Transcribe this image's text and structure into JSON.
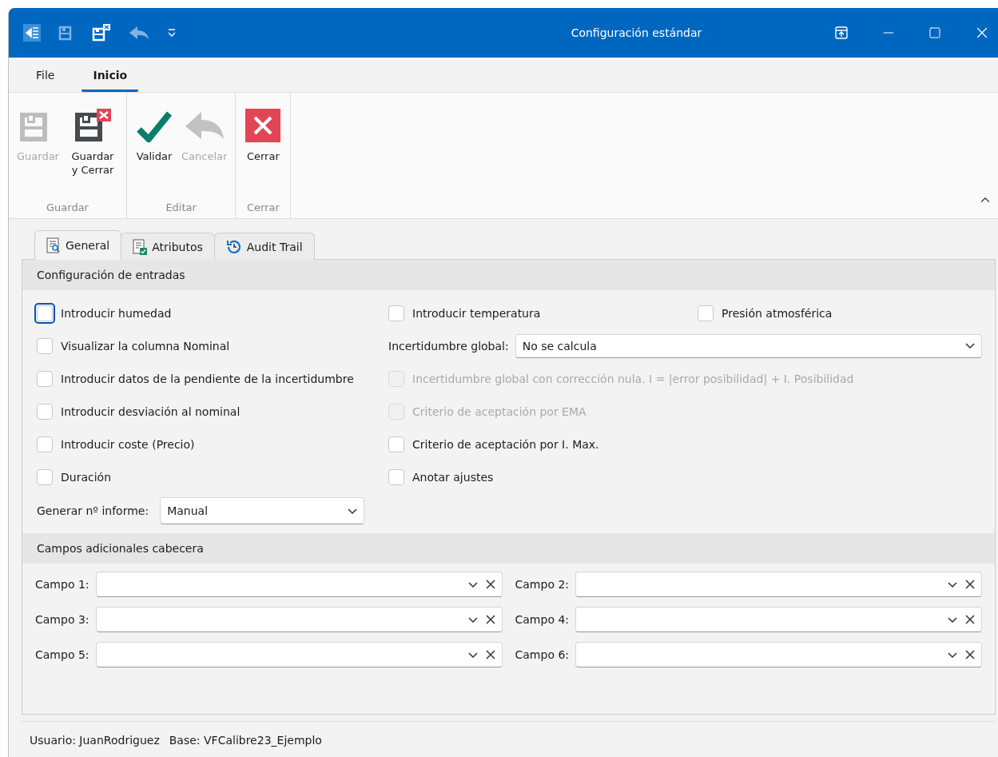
{
  "window": {
    "title": "Configuración estándar"
  },
  "ribbon": {
    "tabs": [
      {
        "label": "File",
        "selected": false
      },
      {
        "label": "Inicio",
        "selected": true
      }
    ],
    "groups": [
      {
        "label": "Guardar",
        "buttons": [
          {
            "label": "Guardar",
            "kind": "save",
            "disabled": true
          },
          {
            "label": "Guardar y Cerrar",
            "kind": "save-close",
            "disabled": false
          }
        ]
      },
      {
        "label": "Editar",
        "buttons": [
          {
            "label": "Validar",
            "kind": "check",
            "disabled": false
          },
          {
            "label": "Cancelar",
            "kind": "undo",
            "disabled": true
          }
        ]
      },
      {
        "label": "Cerrar",
        "buttons": [
          {
            "label": "Cerrar",
            "kind": "close",
            "disabled": false
          }
        ]
      }
    ]
  },
  "document_tabs": [
    {
      "label": "General",
      "kind": "general",
      "selected": true
    },
    {
      "label": "Atributos",
      "kind": "attributes",
      "selected": false
    },
    {
      "label": "Audit Trail",
      "kind": "history",
      "selected": false
    }
  ],
  "entries": {
    "title": "Configuración de entradas",
    "left": [
      {
        "label": "Introducir humedad",
        "checked": false,
        "focused": true
      },
      {
        "label": "Visualizar la columna Nominal",
        "checked": false,
        "focused": false
      },
      {
        "label": "Introducir datos de la pendiente de la incertidumbre",
        "checked": false,
        "focused": false
      },
      {
        "label": "Introducir desviación al nominal",
        "checked": false,
        "focused": false
      },
      {
        "label": "Introducir coste (Precio)",
        "checked": false,
        "focused": false
      },
      {
        "label": "Duración",
        "checked": false,
        "focused": false
      }
    ],
    "right": [
      {
        "kind": "checkbox-pair",
        "items": [
          {
            "label": "Introducir temperatura",
            "checked": false,
            "disabled": false
          },
          {
            "label": "Presión atmosférica",
            "checked": false,
            "disabled": false
          }
        ]
      },
      {
        "kind": "select",
        "label": "Incertidumbre global:",
        "value": "No se calcula"
      },
      {
        "kind": "checkbox",
        "label": "Incertidumbre global con corrección nula. I = |error posibilidad| + I. Posibilidad",
        "checked": false,
        "disabled": true
      },
      {
        "kind": "checkbox",
        "label": "Criterio de aceptación por EMA",
        "checked": false,
        "disabled": true
      },
      {
        "kind": "checkbox",
        "label": "Criterio de aceptación por I. Max.",
        "checked": false,
        "disabled": false
      },
      {
        "kind": "checkbox",
        "label": "Anotar ajustes",
        "checked": false,
        "disabled": false
      }
    ],
    "report_number": {
      "label": "Generar nº informe:",
      "value": "Manual"
    }
  },
  "extra_fields": {
    "title": "Campos adicionales cabecera",
    "fields": [
      {
        "label": "Campo 1:"
      },
      {
        "label": "Campo 2:"
      },
      {
        "label": "Campo 3:"
      },
      {
        "label": "Campo 4:"
      },
      {
        "label": "Campo 5:"
      },
      {
        "label": "Campo 6:"
      }
    ]
  },
  "status_bar": {
    "user": "Usuario: JuanRodriguez",
    "base": "Base: VFCalibre23_Ejemplo"
  }
}
